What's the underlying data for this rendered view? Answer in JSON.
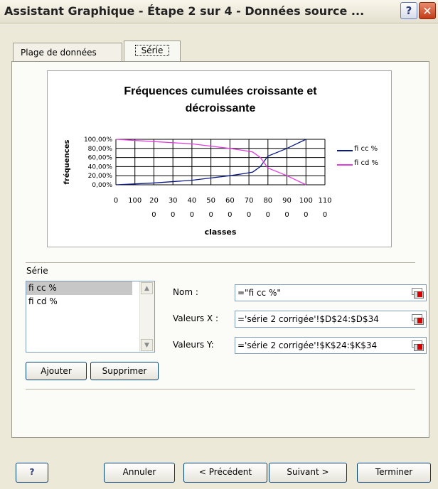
{
  "window": {
    "title": "Assistant Graphique - Étape 2 sur 4 - Données source ...",
    "help_symbol": "?",
    "close_symbol": "✕"
  },
  "tabs": [
    {
      "label": "Plage de données",
      "active": false
    },
    {
      "label": "Série",
      "active": true
    }
  ],
  "chart_data": {
    "type": "line",
    "title_line1": "Fréquences cumulées croissante et",
    "title_line2": "décroissante",
    "xlabel": "classes",
    "ylabel": "fréquences",
    "y_ticks": [
      "100,00%",
      "80,00%",
      "60,00%",
      "40,00%",
      "20,00%",
      "0,00%"
    ],
    "x_ticks_top": [
      "0",
      "100",
      "20",
      "30",
      "40",
      "50",
      "60",
      "70",
      "80",
      "90",
      "100",
      "110"
    ],
    "x_ticks_bottom": [
      "",
      "",
      "0",
      "0",
      "0",
      "0",
      "0",
      "0",
      "0",
      "0",
      "0",
      "0"
    ],
    "xlim": [
      0,
      1100
    ],
    "ylim": [
      0,
      100
    ],
    "grid": true,
    "legend_position": "right",
    "series": [
      {
        "name": "fi cc %",
        "color": "#0a1a84",
        "x": [
          0,
          200,
          400,
          500,
          600,
          680,
          720,
          760,
          800,
          900,
          1000
        ],
        "y": [
          0,
          4,
          10,
          15,
          20,
          25,
          28,
          40,
          63,
          80,
          100
        ]
      },
      {
        "name": "fi cd %",
        "color": "#e33ce0",
        "x": [
          0,
          200,
          400,
          500,
          600,
          680,
          720,
          760,
          800,
          900,
          1000
        ],
        "y": [
          100,
          95,
          90,
          85,
          80,
          75,
          72,
          60,
          37,
          20,
          0
        ]
      }
    ]
  },
  "serie_section": {
    "label": "Série",
    "items": [
      "fi cc %",
      "fi cd %"
    ],
    "selected_index": 0,
    "add_button": "Ajouter",
    "remove_button": "Supprimer"
  },
  "fields": {
    "nom_label": "Nom :",
    "nom_value": "=\"fi cc %\"",
    "x_label": "Valeurs X :",
    "x_value": "='série 2 corrigée'!$D$24:$D$34",
    "y_label": "Valeurs Y:",
    "y_value": "='série 2 corrigée'!$K$24:$K$34"
  },
  "footer": {
    "help_symbol": "?",
    "cancel": "Annuler",
    "previous": "< Précédent",
    "next": "Suivant >",
    "finish": "Terminer"
  }
}
